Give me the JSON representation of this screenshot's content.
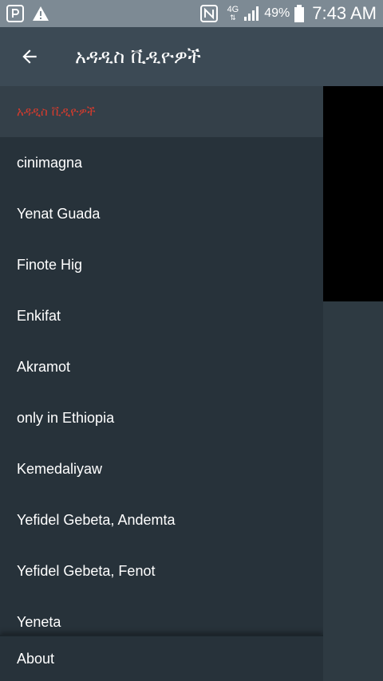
{
  "status_bar": {
    "battery_percent": "49%",
    "network_type": "4G",
    "clock": "7:43 AM",
    "icons": [
      "app-notification-icon",
      "warning-icon",
      "nfc-icon",
      "data-arrows-icon",
      "signal-icon",
      "battery-icon"
    ]
  },
  "app_bar": {
    "title": "አዳዲስ ቪዲዮዎች",
    "back_icon": "arrow-back-icon"
  },
  "drawer": {
    "header": "አዳዲስ ቪዲዮዎች",
    "items": [
      {
        "label": "cinimagna"
      },
      {
        "label": "Yenat Guada"
      },
      {
        "label": "Finote Hig"
      },
      {
        "label": "Enkifat"
      },
      {
        "label": "Akramot"
      },
      {
        "label": "only in Ethiopia"
      },
      {
        "label": "Kemedaliyaw"
      },
      {
        "label": "Yefidel Gebeta, Andemta"
      },
      {
        "label": "Yefidel Gebeta, Fenot"
      },
      {
        "label": "Yeneta"
      }
    ],
    "footer": "About"
  },
  "colors": {
    "status_bar_bg": "#7d8a94",
    "app_bar_bg": "#3c4a55",
    "drawer_bg": "#27323a",
    "drawer_header_bg": "#344049",
    "header_text": "#d13b2e"
  }
}
